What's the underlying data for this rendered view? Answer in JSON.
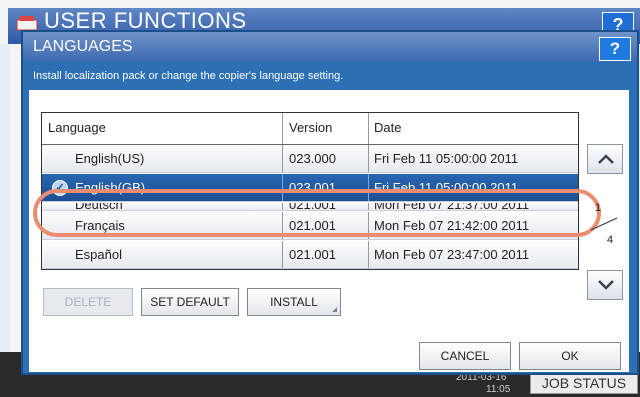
{
  "background": {
    "title": "USER FUNCTIONS",
    "help_label": "?",
    "clock_date": "2011-03-16",
    "clock_time": "11:05",
    "job_status": "JOB STATUS"
  },
  "dialog": {
    "title": "LANGUAGES",
    "help_label": "?",
    "description": "Install localization pack or change the copier's language setting."
  },
  "table": {
    "headers": {
      "language": "Language",
      "version": "Version",
      "date": "Date"
    },
    "rows": [
      {
        "language": "English(US)",
        "version": "023.000",
        "date": "Fri Feb 11 05:00:00 2011",
        "selected": false
      },
      {
        "language": "English(GB)",
        "version": "023.001",
        "date": "Fri Feb 11 05:00:00 2011",
        "selected": true
      },
      {
        "language": "Deutsch",
        "version": "021.001",
        "date": "Mon Feb 07 21:37:00 2011",
        "selected": false
      },
      {
        "language": "Français",
        "version": "021.001",
        "date": "Mon Feb 07 21:42:00 2011",
        "selected": false
      },
      {
        "language": "Español",
        "version": "021.001",
        "date": "Mon Feb 07 23:47:00 2011",
        "selected": false
      }
    ]
  },
  "pagination": {
    "current": "1",
    "total": "4"
  },
  "buttons": {
    "delete": "DELETE",
    "set_default": "SET DEFAULT",
    "install": "INSTALL",
    "cancel": "CANCEL",
    "ok": "OK"
  },
  "colors": {
    "selection": "#1e4f94",
    "highlight": "#eb8d72",
    "dialog_frame": "#2d6fb4"
  },
  "icons": {
    "check": "checkmark-icon",
    "scroll_up": "chevron-up-icon",
    "scroll_down": "chevron-down-icon"
  }
}
